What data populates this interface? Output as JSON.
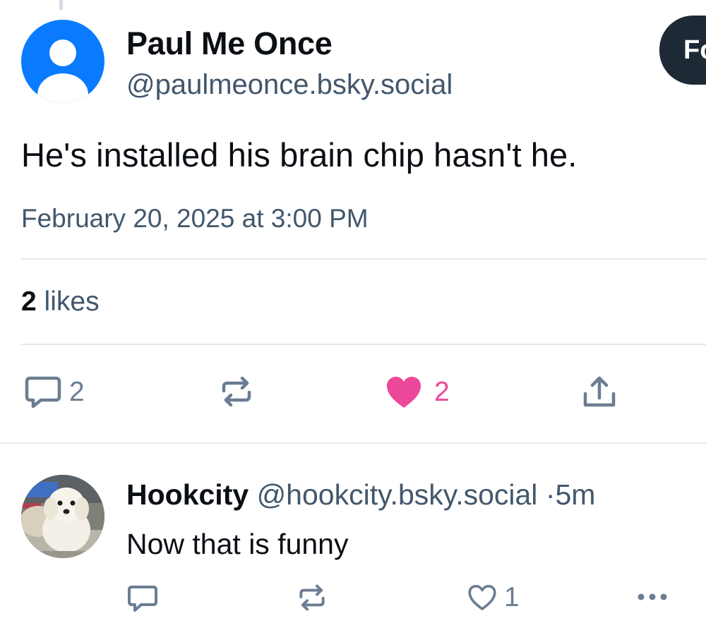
{
  "post": {
    "author_name": "Paul Me Once",
    "author_handle": "@paulmeonce.bsky.social",
    "follow_label": "Fo",
    "text": "He's installed his brain chip hasn't he.",
    "timestamp": "February 20, 2025 at 3:00 PM",
    "likes_count": "2",
    "likes_label": "likes",
    "actions": {
      "reply_icon": "reply-bubble-icon",
      "reply_count": "2",
      "repost_icon": "repost-icon",
      "like_icon": "heart-filled-icon",
      "like_count": "2",
      "share_icon": "share-icon"
    }
  },
  "reply": {
    "author_name": "Hookcity",
    "author_handle": "@hookcity.bsky.social",
    "separator": "·",
    "age": "5m",
    "text": "Now that is funny",
    "actions": {
      "reply_icon": "reply-bubble-icon",
      "repost_icon": "repost-icon",
      "like_icon": "heart-outline-icon",
      "like_count": "1",
      "more_icon": "more-dots-icon"
    }
  },
  "colors": {
    "avatar_default": "#0a7aff",
    "muted_text": "#42576c",
    "icon": "#6b7d92",
    "like_pink": "#ec4899",
    "follow_button": "#1e2936",
    "divider": "#e4e9ee"
  }
}
